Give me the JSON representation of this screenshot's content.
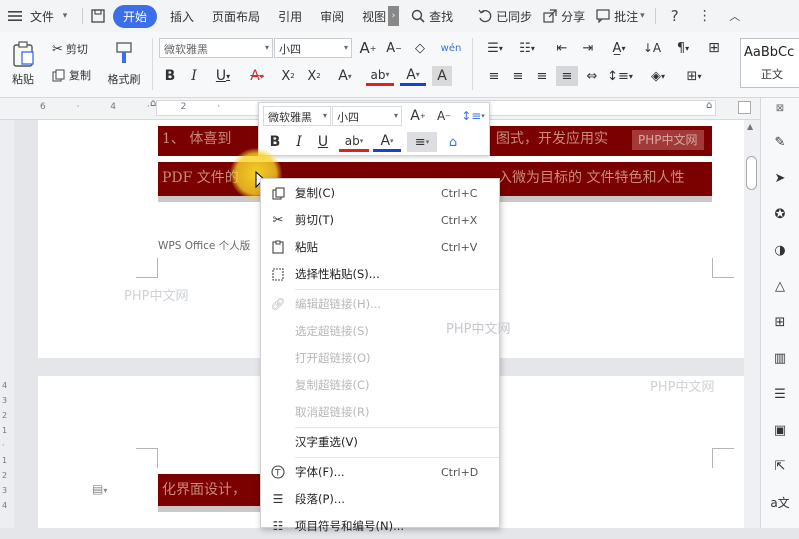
{
  "menubar": {
    "file": "文件",
    "tabs": [
      "开始",
      "插入",
      "页面布局",
      "引用",
      "审阅",
      "视图"
    ],
    "search": "查找",
    "sync": "已同步",
    "share": "分享",
    "comment": "批注"
  },
  "ribbon": {
    "paste": "粘贴",
    "cut": "剪切",
    "copy": "复制",
    "format_painter": "格式刷",
    "font_name": "微软雅黑",
    "font_size": "小四",
    "style_preview": "AaBbCc",
    "style_name": "正文"
  },
  "floating_toolbar": {
    "font_name": "微软雅黑",
    "font_size": "小四"
  },
  "document": {
    "line1_left": "1、 体喜到",
    "line1_right": "图式，开发应用实",
    "line1_tag": "PHP中文网",
    "line2_left": "PDF 文件的",
    "line2_right": "入微为目标的 文件特色和人性",
    "header_note": "WPS Office 个人版",
    "page2_line": "化界面设计，",
    "watermark": "PHP中文网"
  },
  "context_menu": {
    "items": [
      {
        "label": "复制(C)",
        "shortcut": "Ctrl+C"
      },
      {
        "label": "剪切(T)",
        "shortcut": "Ctrl+X"
      },
      {
        "label": "粘贴",
        "shortcut": "Ctrl+V"
      },
      {
        "label": "选择性粘贴(S)...",
        "shortcut": ""
      },
      {
        "label": "编辑超链接(H)...",
        "shortcut": ""
      },
      {
        "label": "选定超链接(S)",
        "shortcut": ""
      },
      {
        "label": "打开超链接(O)",
        "shortcut": ""
      },
      {
        "label": "复制超链接(C)",
        "shortcut": ""
      },
      {
        "label": "取消超链接(R)",
        "shortcut": ""
      },
      {
        "label": "汉字重选(V)",
        "shortcut": ""
      },
      {
        "label": "字体(F)...",
        "shortcut": "Ctrl+D"
      },
      {
        "label": "段落(P)...",
        "shortcut": ""
      },
      {
        "label": "项目符号和编号(N)...",
        "shortcut": ""
      }
    ]
  },
  "colors": {
    "accent": "#3b6ee8",
    "highlight": "#7b0000"
  }
}
